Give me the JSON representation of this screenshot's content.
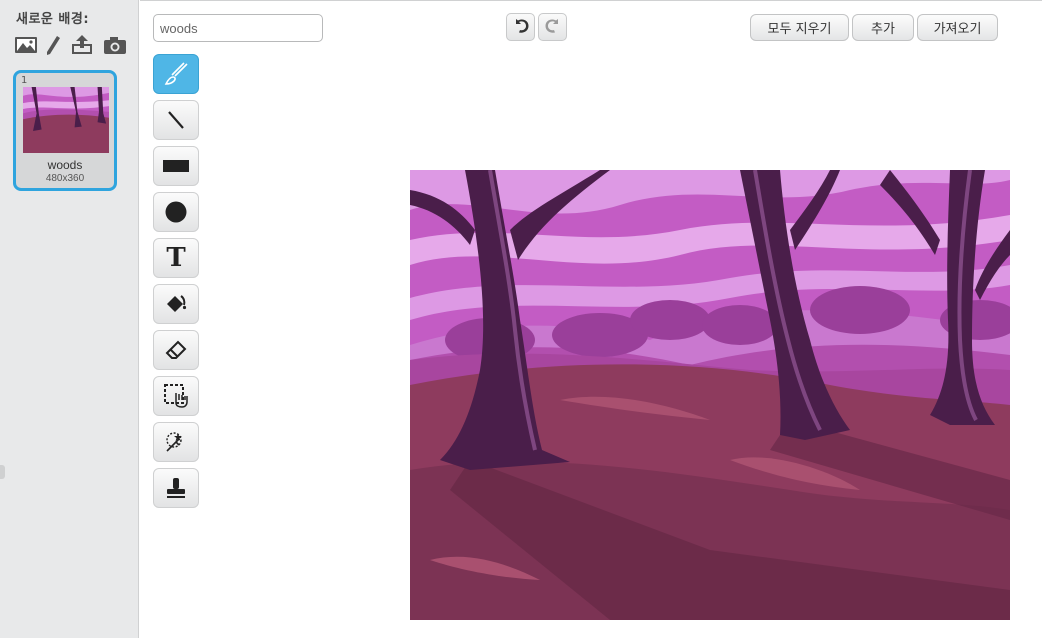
{
  "backdrop_panel": {
    "new_backdrop_label": "새로운 배경:",
    "new_backdrop_icons": [
      "choose-from-library-icon",
      "paint-new-icon",
      "upload-icon",
      "camera-icon"
    ]
  },
  "backdrop_list": [
    {
      "index": "1",
      "name": "woods",
      "size": "480x360",
      "selected": true
    }
  ],
  "editor": {
    "backdrop_name": "woods",
    "buttons": {
      "clear": "모두 지우기",
      "add": "추가",
      "import": "가져오기"
    },
    "undo_icon": "undo-icon",
    "redo_icon": "redo-icon",
    "tools": [
      {
        "name": "brush-icon",
        "active": true
      },
      {
        "name": "line-icon",
        "active": false
      },
      {
        "name": "rectangle-icon",
        "active": false
      },
      {
        "name": "ellipse-icon",
        "active": false
      },
      {
        "name": "text-icon",
        "active": false
      },
      {
        "name": "fill-icon",
        "active": false
      },
      {
        "name": "eraser-icon",
        "active": false
      },
      {
        "name": "select-icon",
        "active": false
      },
      {
        "name": "reshape-icon",
        "active": false
      },
      {
        "name": "stamp-icon",
        "active": false
      }
    ],
    "text_tool_glyph": "T"
  },
  "colors": {
    "accent": "#2fa4de",
    "active_tool": "#4fb6e6",
    "sky": "#c35cc4",
    "ground": "#8e3b5e",
    "tree": "#4a1e4a"
  }
}
